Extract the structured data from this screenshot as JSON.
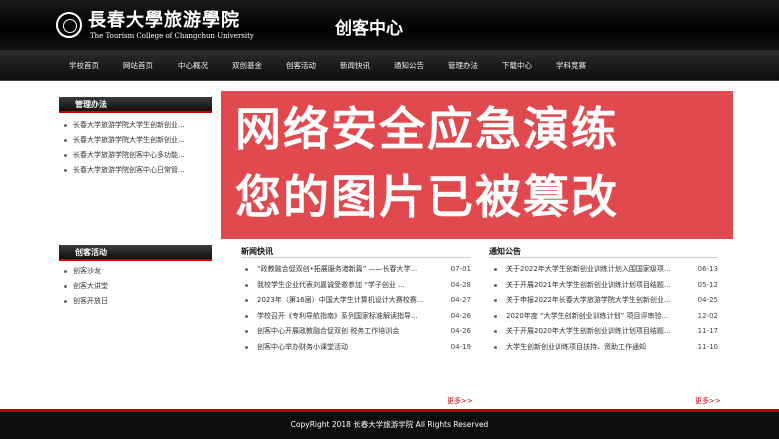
{
  "header": {
    "logo_cn": "長春大學旅游學院",
    "logo_en": "The Tourism College of Changchun University",
    "site_title": "创客中心"
  },
  "nav": [
    "学校首页",
    "网站首页",
    "中心概况",
    "双创基金",
    "创客活动",
    "新闻快讯",
    "通知公告",
    "管理办法",
    "下载中心",
    "学科竞赛"
  ],
  "sidebar": {
    "manage": {
      "title": "管理办法",
      "items": [
        "长春大学旅游学院大学生创新创业...",
        "长春大学旅游学院大学生创新创业...",
        "长春大学旅游学院创客中心多功能...",
        "长春大学旅游学院创客中心日常管..."
      ]
    },
    "activities": {
      "title": "创客活动",
      "items": [
        "创客沙龙",
        "创客大讲堂",
        "创客开放日"
      ]
    }
  },
  "banner": {
    "line1": "网络安全应急演练",
    "line2": "您的图片已被篡改"
  },
  "news": {
    "title": "新闻快讯",
    "items": [
      {
        "t": "“政教融合促双创•拓展服务港新篇” ——长春大学...",
        "d": "07-01"
      },
      {
        "t": "我校学生企业代表刘嘉诚受邀参加 “学子创业 ...",
        "d": "04-28"
      },
      {
        "t": "2023年（第16届）中国大学生计算机设计大赛校赛...",
        "d": "04-27"
      },
      {
        "t": "学校召开《专利导航指南》系列国家标准解读指导...",
        "d": "04-26"
      },
      {
        "t": "创客中心开展政教融合促双创 税务工作培训会",
        "d": "04-26"
      },
      {
        "t": "创客中心举办财务小课堂活动",
        "d": "04-19"
      }
    ],
    "more": "更多>>"
  },
  "notices": {
    "title": "通知公告",
    "items": [
      {
        "t": "关于2022年大学生创新创业训练计划入围国家级项...",
        "d": "06-13"
      },
      {
        "t": "关于开展2021年大学生创新创业训练计划项目结题...",
        "d": "05-12"
      },
      {
        "t": "关于申报2022年长春大学旅游学院大学生创新创业...",
        "d": "04-25"
      },
      {
        "t": "2020年度 “大学生创新创业训练计划” 项目评审验...",
        "d": "12-02"
      },
      {
        "t": "关于开展2020年大学生创新创业训练计划项目结题...",
        "d": "11-17"
      },
      {
        "t": "大学生创新创业训练项目扶持、资助工作通知",
        "d": "11-10"
      }
    ],
    "more": "更多>>"
  },
  "footer": "CopyRight 2018 长春大学旅游学院 All Rights Reserved"
}
